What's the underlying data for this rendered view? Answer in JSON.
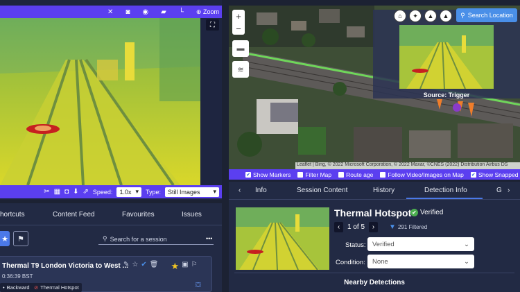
{
  "video": {
    "zoom_label": "Zoom",
    "speed_label": "Speed:",
    "speed_value": "1.0x",
    "type_label": "Type:",
    "type_value": "Still Images"
  },
  "sessions": {
    "tabs": [
      "hortcuts",
      "Content Feed",
      "Favourites",
      "Issues"
    ],
    "search_placeholder": "Search for a session",
    "card": {
      "title": "Thermal T9 London Victoria to West ...",
      "time": "0:36:39 BST",
      "direction": "Backward",
      "tag": "Thermal Hotspot"
    }
  },
  "map": {
    "search_location": "Search Location",
    "trigger_caption": "Source: Trigger",
    "attribution": "Leaflet | Bing, © 2022 Microsoft Corporation, © 2022 Maxar, ©CNES (2022) Distribution Airbus DS",
    "options": [
      "Show Markers",
      "Filter Map",
      "Route age",
      "Follow Video/Images on Map",
      "Show Snapped Route"
    ]
  },
  "detail": {
    "tabs": [
      "Info",
      "Session Content",
      "History",
      "Detection Info",
      "G"
    ],
    "title": "Thermal Hotspot",
    "verified": "Verified",
    "pager": "1 of 5",
    "filtered": "291 Filtered",
    "status_label": "Status:",
    "status_value": "Verified",
    "condition_label": "Condition:",
    "condition_value": "None",
    "nearby": "Nearby Detections"
  },
  "colors": {
    "accent": "#5b3ff0",
    "panel": "#222a44",
    "button_blue": "#4a8fe8"
  }
}
